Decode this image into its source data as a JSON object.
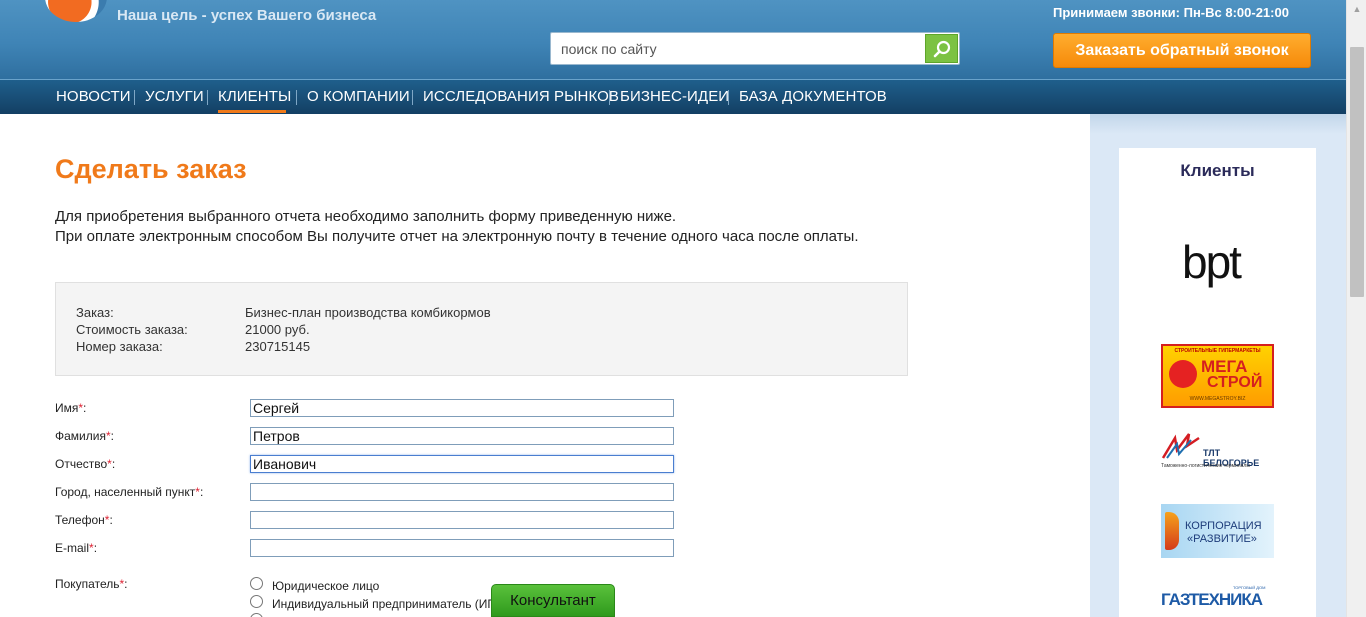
{
  "header": {
    "tagline": "Наша цель - успех Вашего бизнеса",
    "search_placeholder": "поиск по сайту",
    "phone_hours": "Принимаем звонки: Пн-Вс 8:00-21:00",
    "callback_label": "Заказать обратный звонок"
  },
  "nav": {
    "items": [
      {
        "label": "НОВОСТИ"
      },
      {
        "label": "УСЛУГИ"
      },
      {
        "label": "КЛИЕНТЫ"
      },
      {
        "label": "О КОМПАНИИ"
      },
      {
        "label": "ИССЛЕДОВАНИЯ РЫНКОВ"
      },
      {
        "label": "БИЗНЕС-ИДЕИ"
      },
      {
        "label": "БАЗА ДОКУМЕНТОВ"
      }
    ],
    "active": "КЛИЕНТЫ"
  },
  "main": {
    "title": "Сделать заказ",
    "intro_line1": "Для приобретения выбранного отчета необходимо заполнить форму приведенную ниже.",
    "intro_line2": "При оплате электронным способом Вы получите отчет на электронную почту в течение одного часа после оплаты."
  },
  "order": {
    "order_label": "Заказ:",
    "order_value": "Бизнес-план производства комбикормов",
    "cost_label": "Стоимость заказа:",
    "cost_value": "21000 руб.",
    "number_label": "Номер заказа:",
    "number_value": "230715145"
  },
  "form": {
    "fields": [
      {
        "label": "Имя",
        "value": "Сергей"
      },
      {
        "label": "Фамилия",
        "value": "Петров"
      },
      {
        "label": "Отчество",
        "value": "Иванович"
      },
      {
        "label": "Город, населенный пункт",
        "value": ""
      },
      {
        "label": "Телефон",
        "value": ""
      },
      {
        "label": "E-mail",
        "value": ""
      }
    ],
    "buyer_label": "Покупатель",
    "buyer_options": [
      {
        "label": "Юридическое лицо"
      },
      {
        "label": "Индивидуальный предприниматель (ИП)"
      }
    ],
    "required_mark": "*",
    "colon": ":"
  },
  "sidebar": {
    "title": "Клиенты",
    "logos": {
      "bpt": "bpt",
      "megastroy_top": "СТРОИТЕЛЬНЫЕ ГИПЕРМАРКЕТЫ",
      "megastroy_1": "МЕГА",
      "megastroy_2": "СТРОЙ",
      "megastroy_url": "WWW.MEGASTROY.BIZ",
      "tlt_name": "ТЛТ БЕЛОГОРЬЕ",
      "tlt_sub": "Таможенно-логистические терминалы",
      "korp_1": "КОРПОРАЦИЯ",
      "korp_2": "«РАЗВИТИЕ»",
      "gaz_td": "ТОРГОВЫЙ ДОМ",
      "gaz": "ГАЗТЕХНИКА"
    }
  },
  "consultant_label": "Консультант",
  "colors": {
    "accent_orange": "#f07a1a",
    "nav_bg": "#1a4f78",
    "search_green": "#7cc242"
  }
}
